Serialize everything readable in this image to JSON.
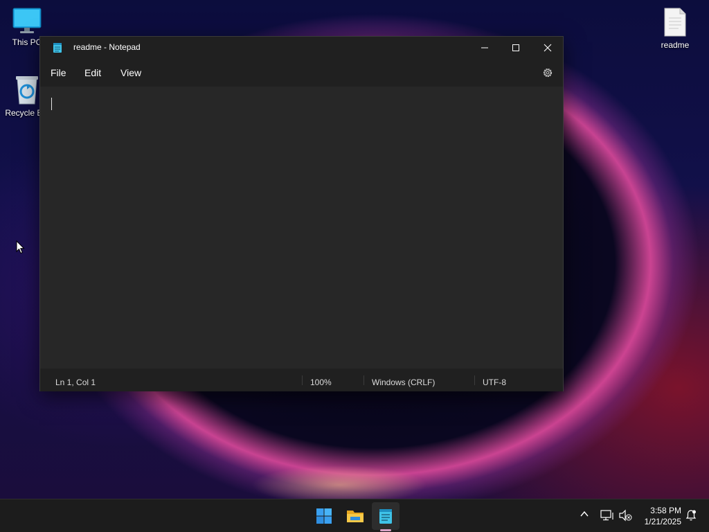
{
  "desktop": {
    "icons": [
      {
        "label": "This PC"
      },
      {
        "label": "Recycle Bin"
      },
      {
        "label": "readme"
      }
    ]
  },
  "window": {
    "title": "readme - Notepad",
    "menu": [
      {
        "label": "File"
      },
      {
        "label": "Edit"
      },
      {
        "label": "View"
      }
    ],
    "editor_text": "",
    "status": {
      "position": "Ln 1, Col 1",
      "zoom": "100%",
      "line_ending": "Windows (CRLF)",
      "encoding": "UTF-8"
    }
  },
  "taskbar": {
    "apps": [
      {
        "icon": "windows-start-icon"
      },
      {
        "icon": "file-explorer-icon"
      },
      {
        "icon": "notepad-icon",
        "active": true
      }
    ],
    "clock": {
      "time": "3:58 PM",
      "date": "1/21/2025"
    }
  },
  "colors": {
    "window_bg": "#202020",
    "editor_bg": "#272727",
    "taskbar_bg": "#1c1c1c",
    "accent_blue": "#2f9fe8"
  }
}
